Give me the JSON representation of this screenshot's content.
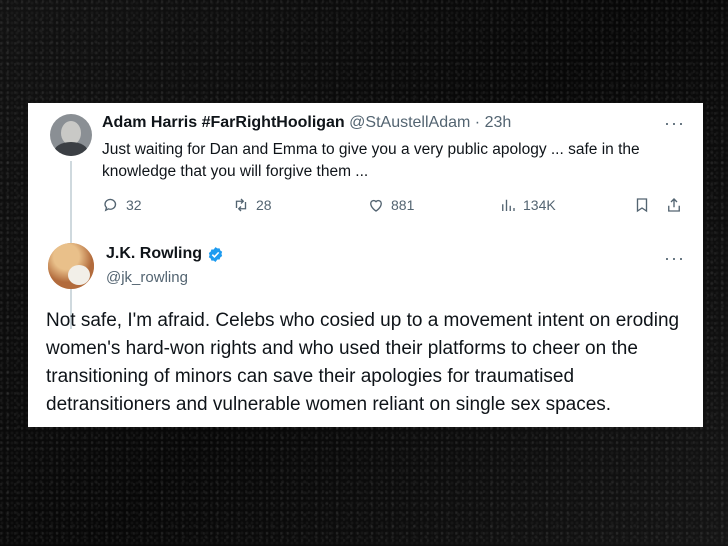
{
  "reply": {
    "name": "Adam Harris #FarRightHooligan",
    "handle": "@StAustellAdam",
    "separator": "·",
    "time": "23h",
    "more": "···",
    "text": "Just waiting for Dan and Emma to give you a very public apology ... safe in the knowledge that you will forgive them ...",
    "stats": {
      "replies": "32",
      "reposts": "28",
      "likes": "881",
      "views": "134K"
    }
  },
  "main": {
    "name": "J.K. Rowling",
    "handle": "@jk_rowling",
    "more": "···",
    "verified_color": "#1d9bf0",
    "text": "Not safe, I'm afraid. Celebs who cosied up to a movement intent on eroding women's hard-won rights and who used their platforms to cheer on the transitioning of minors can save their apologies for traumatised detransitioners and vulnerable women reliant on single sex spaces."
  }
}
